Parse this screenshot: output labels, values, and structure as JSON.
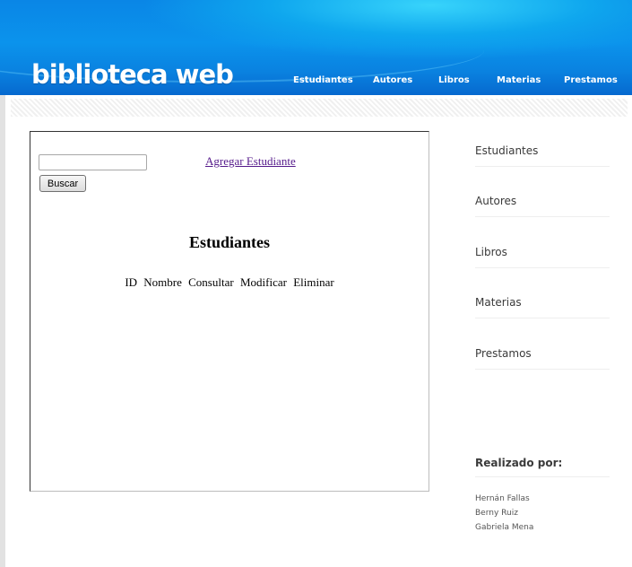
{
  "brand": {
    "logo_text": "biblioteca web"
  },
  "nav": {
    "items": [
      {
        "label": "Estudiantes"
      },
      {
        "label": "Autores"
      },
      {
        "label": "Libros"
      },
      {
        "label": "Materias"
      },
      {
        "label": "Prestamos"
      }
    ]
  },
  "main": {
    "search": {
      "value": "",
      "button_label": "Buscar"
    },
    "add_link": "Agregar Estudiante",
    "title": "Estudiantes",
    "table": {
      "columns": [
        "ID",
        "Nombre",
        "Consultar",
        "Modificar",
        "Eliminar"
      ]
    }
  },
  "sidebar": {
    "items": [
      {
        "label": "Estudiantes"
      },
      {
        "label": "Autores"
      },
      {
        "label": "Libros"
      },
      {
        "label": "Materias"
      },
      {
        "label": "Prestamos"
      }
    ],
    "credits_title": "Realizado por:",
    "credits": [
      "Hernán Fallas",
      "Berny Ruiz",
      "Gabriela Mena"
    ]
  },
  "colors": {
    "header_blue": "#0a86e6",
    "link_visited": "#551a8b",
    "sidebar_text": "#3a3a3a"
  }
}
